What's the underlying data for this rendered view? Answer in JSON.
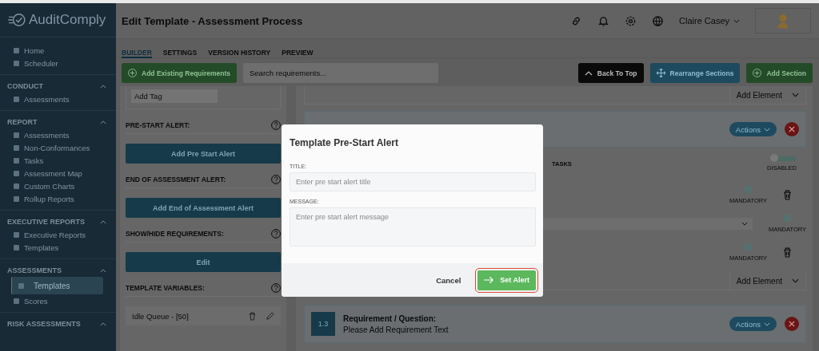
{
  "sidebar": {
    "logo": "AuditComply",
    "top_items": [
      {
        "label": "Home",
        "selected": false
      },
      {
        "label": "Scheduler",
        "selected": false
      }
    ],
    "sections": [
      {
        "title": "CONDUCT",
        "expanded": true,
        "items": [
          {
            "label": "Assessments",
            "selected": false
          }
        ]
      },
      {
        "title": "REPORT",
        "expanded": true,
        "items": [
          {
            "label": "Assessments",
            "selected": false
          },
          {
            "label": "Non-Conformances",
            "selected": false
          },
          {
            "label": "Tasks",
            "selected": false
          },
          {
            "label": "Assessment Map",
            "selected": false
          },
          {
            "label": "Custom Charts",
            "selected": false
          },
          {
            "label": "Rollup Reports",
            "selected": false
          }
        ]
      },
      {
        "title": "EXECUTIVE REPORTS",
        "expanded": true,
        "items": [
          {
            "label": "Executive Reports",
            "selected": false
          },
          {
            "label": "Templates",
            "selected": false
          }
        ]
      },
      {
        "title": "ASSESSMENTS",
        "expanded": true,
        "items": [
          {
            "label": "Templates",
            "selected": true
          },
          {
            "label": "Scores",
            "selected": false
          }
        ]
      },
      {
        "title": "RISK ASSESSMENTS",
        "expanded": true
      }
    ]
  },
  "header": {
    "title": "Edit Template - Assessment Process",
    "user": "Claire Casey"
  },
  "tabs": [
    {
      "label": "BUILDER",
      "selected": true
    },
    {
      "label": "SETTINGS",
      "selected": false
    },
    {
      "label": "VERSION HISTORY",
      "selected": false
    },
    {
      "label": "PREVIEW",
      "selected": false
    }
  ],
  "toolbar": {
    "add_existing": "Add Existing Requirements",
    "search_placeholder": "Search requirements...",
    "back_to_top": "Back To Top",
    "rearrange": "Rearrange Sections",
    "add_section": "Add Section"
  },
  "left_panel": {
    "tag_placeholder": "Add Tag",
    "sections": [
      {
        "title": "PRE-START ALERT:",
        "button": "Add Pre Start Alert"
      },
      {
        "title": "END OF ASSESSMENT ALERT:",
        "button": "Add End of Assessment Alert"
      },
      {
        "title": "SHOW/HIDE REQUIREMENTS:",
        "button": "Edit"
      },
      {
        "title": "TEMPLATE VARIABLES:",
        "variables": [
          "Idle Queue - [50]"
        ]
      }
    ]
  },
  "builder": [
    {
      "kind": "add-element",
      "label": "Add Element"
    },
    {
      "kind": "card-header",
      "actions": "Actions"
    },
    {
      "kind": "tasks",
      "label": "TASKS",
      "toggle_label": "DISABLED",
      "on": false
    },
    {
      "kind": "mandatory",
      "label": "MANDATORY",
      "checked": false
    },
    {
      "kind": "select-mandatory",
      "label": "MANDATORY",
      "checked": false
    },
    {
      "kind": "mandatory",
      "label": "MANDATORY",
      "checked": false
    },
    {
      "kind": "add-element",
      "label": "Add Element"
    },
    {
      "kind": "requirement",
      "number": "1.3",
      "title": "Requirement / Question:",
      "text": "Please Add Requirement Text",
      "actions": "Actions"
    }
  ],
  "modal": {
    "title": "Template Pre-Start Alert",
    "fields": [
      {
        "kind": "input",
        "label": "TITLE:",
        "placeholder": "Enter pre start alert title"
      },
      {
        "kind": "textarea",
        "label": "MESSAGE:",
        "placeholder": "Enter pre start alert message"
      }
    ],
    "cancel": "Cancel",
    "submit": "Set Alert",
    "submit_highlighted": true
  }
}
